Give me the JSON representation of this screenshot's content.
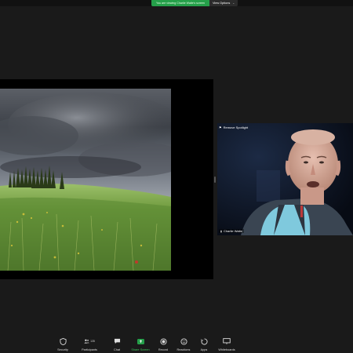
{
  "banner": {
    "message": "You are viewing Charlie Waite's screen",
    "view_options_label": "View Options"
  },
  "video": {
    "spotlight_label": "Remove Spotlight",
    "participant_name": "Charlie Waite"
  },
  "toolbar": {
    "security": "Security",
    "participants": "Participants",
    "participant_count": "135",
    "chat": "Chat",
    "share_screen": "Share Screen",
    "record": "Record",
    "reactions": "Reactions",
    "apps": "Apps",
    "whiteboards": "Whiteboards"
  },
  "colors": {
    "accent_green": "#25a04a",
    "background": "#1a1a1a"
  }
}
